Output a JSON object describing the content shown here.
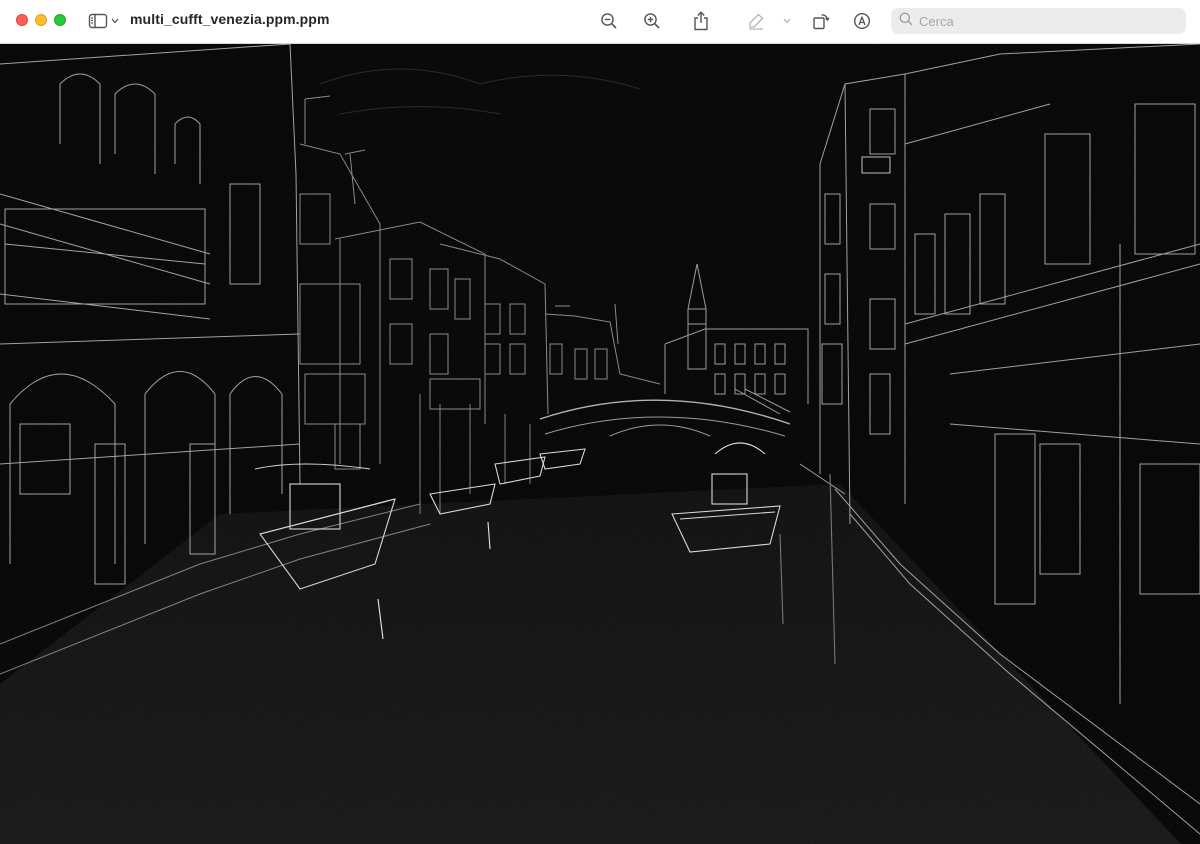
{
  "window": {
    "title": "multi_cufft_venezia.ppm.ppm",
    "traffic_lights": {
      "close_color": "#fe5f57",
      "minimize_color": "#febc2e",
      "zoom_color": "#28c840"
    }
  },
  "toolbar": {
    "icons": {
      "sidebar": "sidebar-icon",
      "chevron": "chevron-down-icon",
      "zoom_out": "zoom-out-icon",
      "zoom_in": "zoom-in-icon",
      "share": "share-icon",
      "highlight": "highlighter-icon",
      "rotate": "rotate-icon",
      "markup": "markup-icon"
    },
    "search": {
      "placeholder": "Cerca",
      "value": "",
      "icon": "search-icon"
    }
  },
  "image": {
    "description_color": "#000000",
    "edge_color": "#cfcfcf"
  }
}
